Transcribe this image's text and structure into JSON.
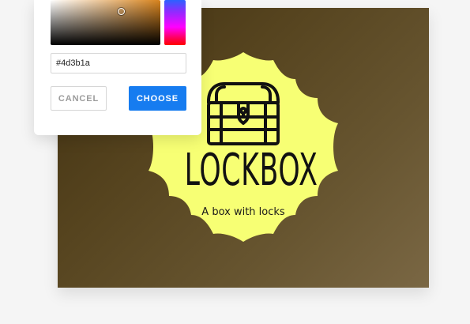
{
  "colors": {
    "page_bg": "#f5f5f5",
    "canvas_gradient_start": "#3f2f10",
    "canvas_gradient_end": "#7a6744",
    "badge_fill": "#f7ff74",
    "ink": "#111111",
    "primary": "#167cf0"
  },
  "logo": {
    "title": "LOCKBOX",
    "subtitle": "A box with locks",
    "icon": "treasure-chest-icon"
  },
  "color_picker": {
    "hex_value": "#4d3b1a",
    "buttons": {
      "cancel_label": "CANCEL",
      "choose_label": "CHOOSE"
    },
    "sv_area": "saturation-value-area",
    "hue_slider": "hue-slider"
  }
}
